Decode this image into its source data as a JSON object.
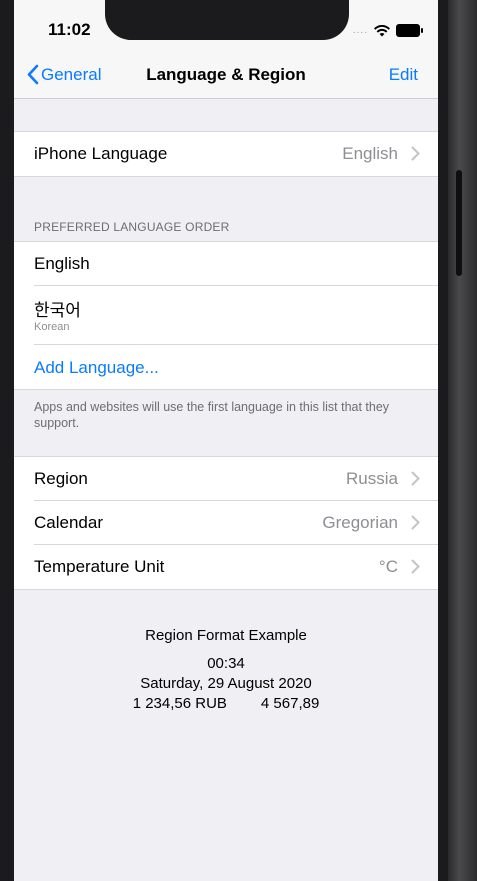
{
  "status_bar": {
    "time": "11:02",
    "signal_dots": "....",
    "wifi_icon": "wifi-icon",
    "battery_icon": "battery-icon"
  },
  "nav": {
    "back_label": "General",
    "title": "Language & Region",
    "edit_label": "Edit",
    "accent_color": "#0a7aff"
  },
  "iphone_language": {
    "label": "iPhone Language",
    "value": "English"
  },
  "preferred": {
    "header": "PREFERRED LANGUAGE ORDER",
    "languages": [
      {
        "name": "English",
        "subtitle": ""
      },
      {
        "name": "한국어",
        "subtitle": "Korean"
      }
    ],
    "add_label": "Add Language...",
    "footer": "Apps and websites will use the first language in this list that they support."
  },
  "region_settings": [
    {
      "label": "Region",
      "value": "Russia"
    },
    {
      "label": "Calendar",
      "value": "Gregorian"
    },
    {
      "label": "Temperature Unit",
      "value": "°C"
    }
  ],
  "format_example": {
    "title": "Region Format Example",
    "time": "00:34",
    "date": "Saturday, 29 August 2020",
    "currency": "1 234,56 RUB",
    "number": "4 567,89"
  }
}
